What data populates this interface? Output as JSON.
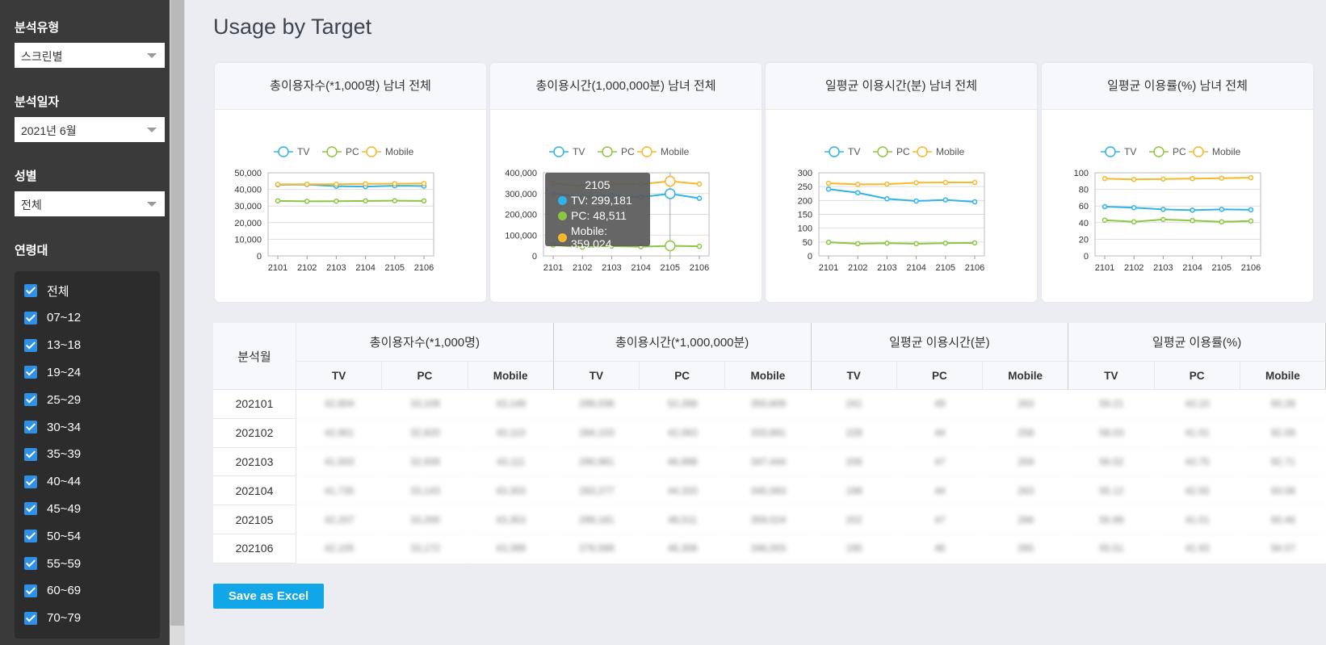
{
  "sidebar": {
    "analysis_type_label": "분석유형",
    "analysis_type_value": "스크린별",
    "analysis_date_label": "분석일자",
    "analysis_date_value": "2021년 6월",
    "gender_label": "성별",
    "gender_value": "전체",
    "age_label": "연령대",
    "age_items": [
      "전체",
      "07~12",
      "13~18",
      "19~24",
      "25~29",
      "30~34",
      "35~39",
      "40~44",
      "45~49",
      "50~54",
      "55~59",
      "60~69",
      "70~79"
    ]
  },
  "page_title": "Usage by Target",
  "colors": {
    "tv": "#2fb3e8",
    "pc": "#8dc641",
    "mobile": "#f7b92b",
    "accent": "#10a6e8"
  },
  "legend": [
    "TV",
    "PC",
    "Mobile"
  ],
  "chart_data": [
    {
      "type": "line",
      "title": "총이용자수(*1,000명) 남녀 전체",
      "categories": [
        "2101",
        "2102",
        "2103",
        "2104",
        "2105",
        "2106"
      ],
      "ylim": [
        0,
        50000
      ],
      "yticks": [
        "0",
        "10,000",
        "20,000",
        "30,000",
        "40,000",
        "50,000"
      ],
      "series": [
        {
          "name": "TV",
          "values": [
            42800,
            42900,
            41900,
            41700,
            42200,
            42000
          ]
        },
        {
          "name": "PC",
          "values": [
            33100,
            32800,
            32900,
            33100,
            33200,
            33100
          ]
        },
        {
          "name": "Mobile",
          "values": [
            43000,
            43100,
            43100,
            43300,
            43400,
            43500
          ]
        }
      ]
    },
    {
      "type": "line",
      "title": "총이용시간(1,000,000분) 남녀 전체",
      "categories": [
        "2101",
        "2102",
        "2103",
        "2104",
        "2105",
        "2106"
      ],
      "ylim": [
        0,
        400000
      ],
      "yticks": [
        "0",
        "100,000",
        "200,000",
        "300,000",
        "400,000"
      ],
      "series": [
        {
          "name": "TV",
          "values": [
            299000,
            284000,
            291000,
            283000,
            299181,
            277000
          ]
        },
        {
          "name": "PC",
          "values": [
            52000,
            42000,
            47000,
            44000,
            48511,
            46000
          ]
        },
        {
          "name": "Mobile",
          "values": [
            350000,
            334000,
            347000,
            345000,
            359024,
            346000
          ]
        }
      ]
    },
    {
      "type": "line",
      "title": "일평균 이용시간(분) 남녀 전체",
      "categories": [
        "2101",
        "2102",
        "2103",
        "2104",
        "2105",
        "2106"
      ],
      "ylim": [
        0,
        300
      ],
      "yticks": [
        "0",
        "50",
        "100",
        "150",
        "200",
        "250",
        "300"
      ],
      "series": [
        {
          "name": "TV",
          "values": [
            241,
            228,
            206,
            198,
            202,
            195
          ]
        },
        {
          "name": "PC",
          "values": [
            49,
            44,
            46,
            44,
            46,
            47
          ]
        },
        {
          "name": "Mobile",
          "values": [
            262,
            258,
            259,
            264,
            265,
            265
          ]
        }
      ]
    },
    {
      "type": "line",
      "title": "일평균 이용률(%) 남녀 전체",
      "categories": [
        "2101",
        "2102",
        "2103",
        "2104",
        "2105",
        "2106"
      ],
      "ylim": [
        0,
        100
      ],
      "yticks": [
        "0",
        "20",
        "40",
        "60",
        "80",
        "100"
      ],
      "series": [
        {
          "name": "TV",
          "values": [
            59.2,
            58.0,
            56.0,
            55.0,
            56.0,
            55.5
          ]
        },
        {
          "name": "PC",
          "values": [
            43.0,
            41.0,
            43.8,
            42.5,
            41.0,
            42.0
          ]
        },
        {
          "name": "Mobile",
          "values": [
            93.0,
            92.0,
            92.5,
            93.0,
            93.5,
            94.0
          ]
        }
      ]
    }
  ],
  "tooltip": {
    "title": "2105",
    "tv": "TV: 299,181",
    "pc": "PC: 48,511",
    "mobile": "Mobile: 359,024"
  },
  "table": {
    "month_header": "분석월",
    "groups": [
      "총이용자수(*1,000명)",
      "총이용시간(*1,000,000분)",
      "일평균 이용시간(분)",
      "일평균 이용률(%)"
    ],
    "sub_headers": [
      "TV",
      "PC",
      "Mobile"
    ],
    "rows": [
      {
        "month": "202101",
        "values": [
          "42,804",
          "33,109",
          "43,149",
          "299,038",
          "52,268",
          "350,609",
          "241",
          "49",
          "263",
          "59.21",
          "43.10",
          "93.28"
        ]
      },
      {
        "month": "202102",
        "values": [
          "42,901",
          "32,820",
          "43,110",
          "284,103",
          "42,063",
          "333,891",
          "228",
          "44",
          "258",
          "58.03",
          "41.01",
          "92.09"
        ]
      },
      {
        "month": "202103",
        "values": [
          "41,933",
          "32,939",
          "43,111",
          "290,981",
          "46,998",
          "347,444",
          "206",
          "47",
          "259",
          "56.02",
          "43.75",
          "92.71"
        ]
      },
      {
        "month": "202104",
        "values": [
          "41,735",
          "33,143",
          "43,303",
          "283,277",
          "44,333",
          "345,083",
          "198",
          "44",
          "263",
          "55.12",
          "42.55",
          "93.08"
        ]
      },
      {
        "month": "202105",
        "values": [
          "42,207",
          "33,200",
          "43,353",
          "299,181",
          "48,511",
          "359,024",
          "202",
          "47",
          "266",
          "55.99",
          "41.01",
          "93.46"
        ]
      },
      {
        "month": "202106",
        "values": [
          "42,105",
          "33,172",
          "43,399",
          "276,589",
          "46,308",
          "346,003",
          "195",
          "46",
          "265",
          "55.51",
          "41.93",
          "94.07"
        ]
      }
    ]
  },
  "save_button_label": "Save as Excel"
}
